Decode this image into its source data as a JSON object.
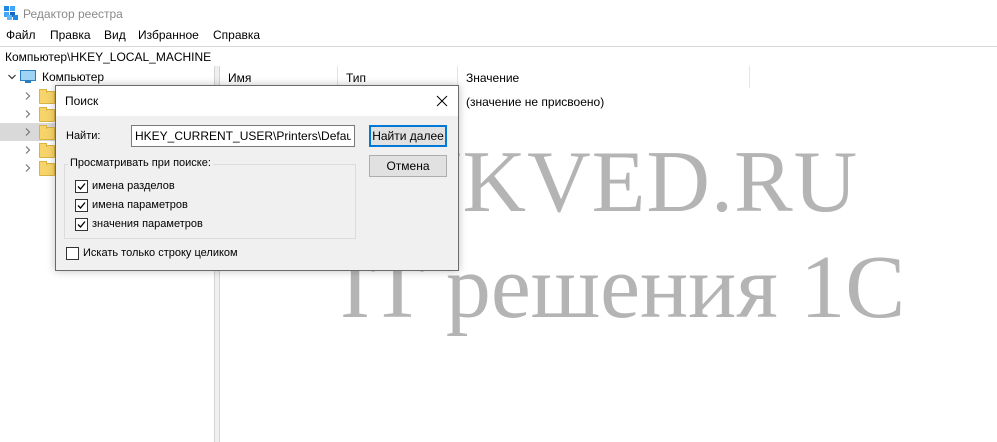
{
  "window": {
    "title": "Редактор реестра",
    "app_icon": "registry-editor-icon"
  },
  "menu": {
    "items": [
      "Файл",
      "Правка",
      "Вид",
      "Избранное",
      "Справка"
    ]
  },
  "address_bar": {
    "path": "Компьютер\\HKEY_LOCAL_MACHINE"
  },
  "tree": {
    "root_label": "Компьютер",
    "root_icon": "computer-icon",
    "child_icon": "folder-icon"
  },
  "list": {
    "columns": [
      "Имя",
      "Тип",
      "Значение"
    ],
    "rows": [
      {
        "name": "",
        "type": "",
        "value": "(значение не присвоено)"
      }
    ]
  },
  "dialog": {
    "title": "Поиск",
    "find_label": "Найти:",
    "find_value": "HKEY_CURRENT_USER\\Printers\\Defaults\\",
    "find_next_label": "Найти далее",
    "cancel_label": "Отмена",
    "look_at_label": "Просматривать при поиске:",
    "options": [
      {
        "label": "имена разделов",
        "checked": true
      },
      {
        "label": "имена параметров",
        "checked": true
      },
      {
        "label": "значения параметров",
        "checked": true
      }
    ],
    "match_whole": {
      "label": "Искать только строку целиком",
      "checked": false
    }
  },
  "watermark": {
    "line1": "UKVED.RU",
    "line2": "IT решения 1С"
  },
  "colors": {
    "accent": "#0078d7",
    "folder": "#f7d46a",
    "watermark": "#b4b4b4",
    "dialog_bg": "#f0f0f0"
  }
}
